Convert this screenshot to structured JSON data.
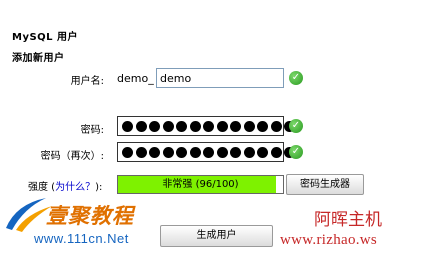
{
  "title": "MySQL 用户",
  "section": "添加新用户",
  "username": {
    "label": "用户名:",
    "prefix": "demo_",
    "value": "demo",
    "check_icon": "check-circle-icon"
  },
  "password": {
    "label": "密码:",
    "mask_count": 13,
    "check_icon": "check-circle-icon"
  },
  "password_confirm": {
    "label": "密码（再次）:",
    "mask_count": 13,
    "check_icon": "check-circle-icon"
  },
  "strength": {
    "label_start": "强度 (",
    "help_link": "为什么？",
    "label_end": "):",
    "text": "非常强 (96/100)",
    "score": 96,
    "fill_color": "#7ef200",
    "generator_button": "密码生成器"
  },
  "submit_button": "生成用户",
  "watermarks": {
    "left_logo_text": "壹聚教程",
    "left_url": "www.111cn.Net",
    "right_name": "阿晖主机",
    "right_url": "www.rizhao.ws"
  },
  "colors": {
    "check_green": "#2a9a20",
    "watermark_red": "#c62828",
    "logo_blue": "#1565c0"
  }
}
